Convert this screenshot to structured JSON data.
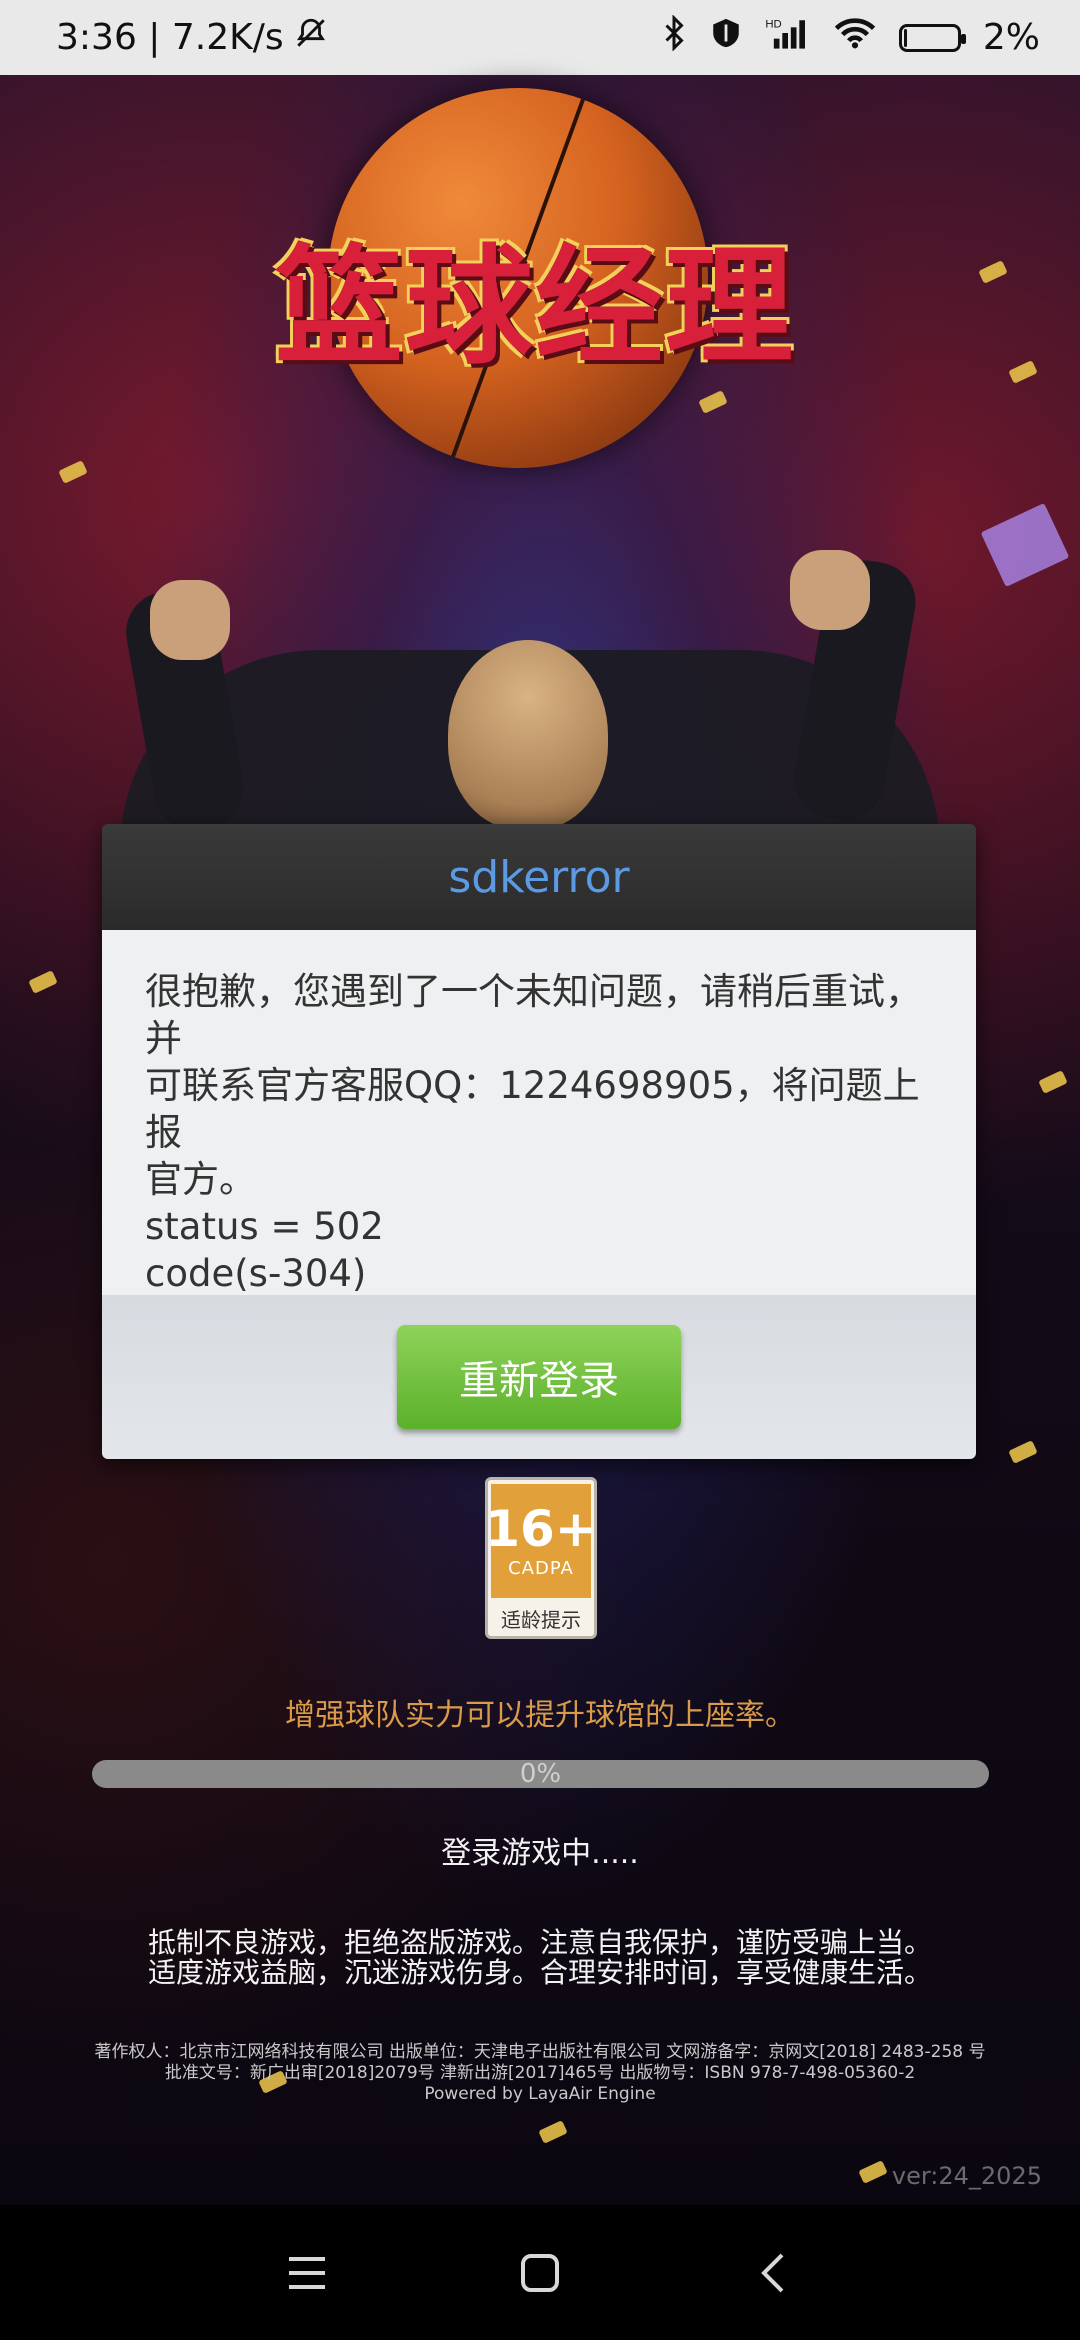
{
  "status_bar": {
    "time_speed": "3:36 | 7.2K/s",
    "battery": "2%",
    "icons": [
      "mute-icon",
      "bluetooth-icon",
      "shield-icon",
      "hd-signal-icon",
      "wifi-icon",
      "battery-icon"
    ]
  },
  "game": {
    "title": "篮球经理"
  },
  "dialog": {
    "title": "sdkerror",
    "message_line1": "很抱歉，您遇到了一个未知问题，请稍后重试，并",
    "message_line2": "可联系官方客服QQ：1224698905，将问题上报",
    "message_line3": "官方。",
    "status": "status = 502",
    "code": "code(s-304)",
    "button": "重新登录"
  },
  "age_rating": {
    "number": "16+",
    "org": "CADPA",
    "note": "适龄提示"
  },
  "tip": "增强球队实力可以提升球馆的上座率。",
  "progress": {
    "percent": 0,
    "label": "0%"
  },
  "loading_text": "登录游戏中.....",
  "health_tip": {
    "line1": "抵制不良游戏，拒绝盗版游戏。注意自我保护，谨防受骗上当。",
    "line2": "适度游戏益脑，沉迷游戏伤身。合理安排时间，享受健康生活。"
  },
  "copyright": {
    "line1": "著作权人：北京市江网络科技有限公司 出版单位：天津电子出版社有限公司 文网游备字：京网文[2018] 2483-258 号",
    "line2": "批准文号：新广出审[2018]2079号   津新出游[2017]465号    出版物号：ISBN 978-7-498-05360-2",
    "line3": "Powered by LayaAir Engine"
  },
  "version": "ver:24_2025",
  "nav": {
    "icons": [
      "menu-icon",
      "home-icon",
      "back-icon"
    ]
  },
  "colors": {
    "dialog_title": "#5b9be6",
    "button_green": "#5bb12a",
    "tip_orange": "#d99a4a"
  }
}
